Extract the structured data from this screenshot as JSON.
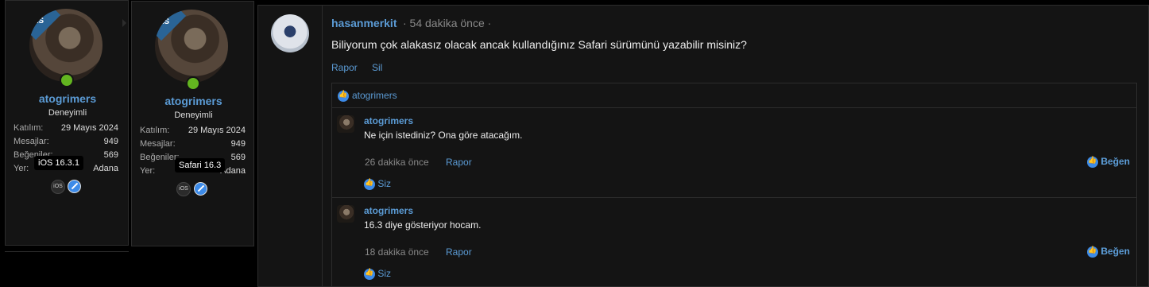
{
  "cards": [
    {
      "ks": "KS",
      "username": "atogrimers",
      "title": "Deneyimli",
      "stats": [
        {
          "label": "Katılım:",
          "value": "29 Mayıs 2024"
        },
        {
          "label": "Mesajlar:",
          "value": "949"
        },
        {
          "label": "Beğeniler:",
          "value": "569"
        },
        {
          "label": "Yer:",
          "value": "Adana"
        }
      ],
      "tooltip": "iOS 16.3.1",
      "os_label": "iOS"
    },
    {
      "ks": "KS",
      "username": "atogrimers",
      "title": "Deneyimli",
      "stats": [
        {
          "label": "Katılım:",
          "value": "29 Mayıs 2024"
        },
        {
          "label": "Mesajlar:",
          "value": "949"
        },
        {
          "label": "Beğeniler:",
          "value": "569"
        },
        {
          "label": "Yer:",
          "value": "Adana"
        }
      ],
      "tooltip": "Safari 16.3",
      "os_label": "iOS"
    }
  ],
  "post": {
    "author": "hasanmerkit",
    "time": "· 54 dakika önce ·",
    "body": "Biliyorum çok alakasız olacak ancak kullandığınız Safari sürümünü yazabilir misiniz?",
    "actions": [
      "Rapor",
      "Sil"
    ],
    "liked_by": "atogrimers"
  },
  "replies": [
    {
      "author": "atogrimers",
      "body": "Ne için istediniz? Ona göre atacağım.",
      "time": "26 dakika önce",
      "report": "Rapor",
      "like": "Beğen",
      "liked_by": "Siz"
    },
    {
      "author": "atogrimers",
      "body": "16.3 diye gösteriyor hocam.",
      "time": "18 dakika önce",
      "report": "Rapor",
      "like": "Beğen",
      "liked_by": "Siz"
    }
  ]
}
